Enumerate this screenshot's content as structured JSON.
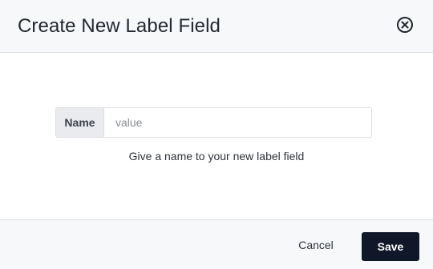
{
  "dialog": {
    "title": "Create New Label Field",
    "close_icon": "close-circle-icon"
  },
  "form": {
    "name_label": "Name",
    "name_placeholder": "value",
    "name_value": "",
    "help_text": "Give a name to your new label field"
  },
  "footer": {
    "cancel_label": "Cancel",
    "save_label": "Save"
  },
  "colors": {
    "save_button_bg": "#0f1728",
    "header_bg": "#f7f8fa"
  }
}
